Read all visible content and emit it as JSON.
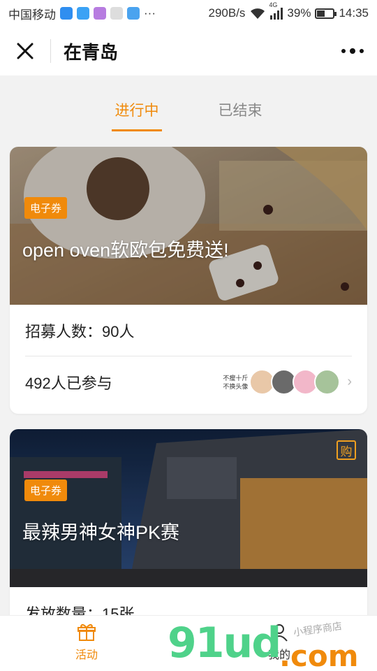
{
  "status_bar": {
    "carrier": "中国移动",
    "more": "···",
    "net_speed": "290B/s",
    "network_type": "4G",
    "battery": "39%",
    "time": "14:35"
  },
  "title_bar": {
    "title": "在青岛"
  },
  "tabs": [
    {
      "label": "进行中",
      "active": true
    },
    {
      "label": "已结束",
      "active": false
    }
  ],
  "cards": [
    {
      "badge": "电子券",
      "title": "open oven软欧包免费送!",
      "row1": "招募人数：90人",
      "row2": "492人已参与",
      "avatar_caption_1": "不瘦十斤",
      "avatar_caption_2": "不换头像"
    },
    {
      "badge": "电子券",
      "title": "最辣男神女神PK赛",
      "buy_icon_text": "购",
      "row1": "发放数量：15张"
    }
  ],
  "bottom_nav": [
    {
      "label": "活动",
      "icon": "gift-icon",
      "active": true
    },
    {
      "label": "我的",
      "icon": "user-icon",
      "active": false
    }
  ],
  "watermark": {
    "main": "91ud",
    "suffix": ".com",
    "sub": "小程序商店"
  },
  "colors": {
    "accent": "#f08a0b",
    "background": "#f2f2f2"
  }
}
